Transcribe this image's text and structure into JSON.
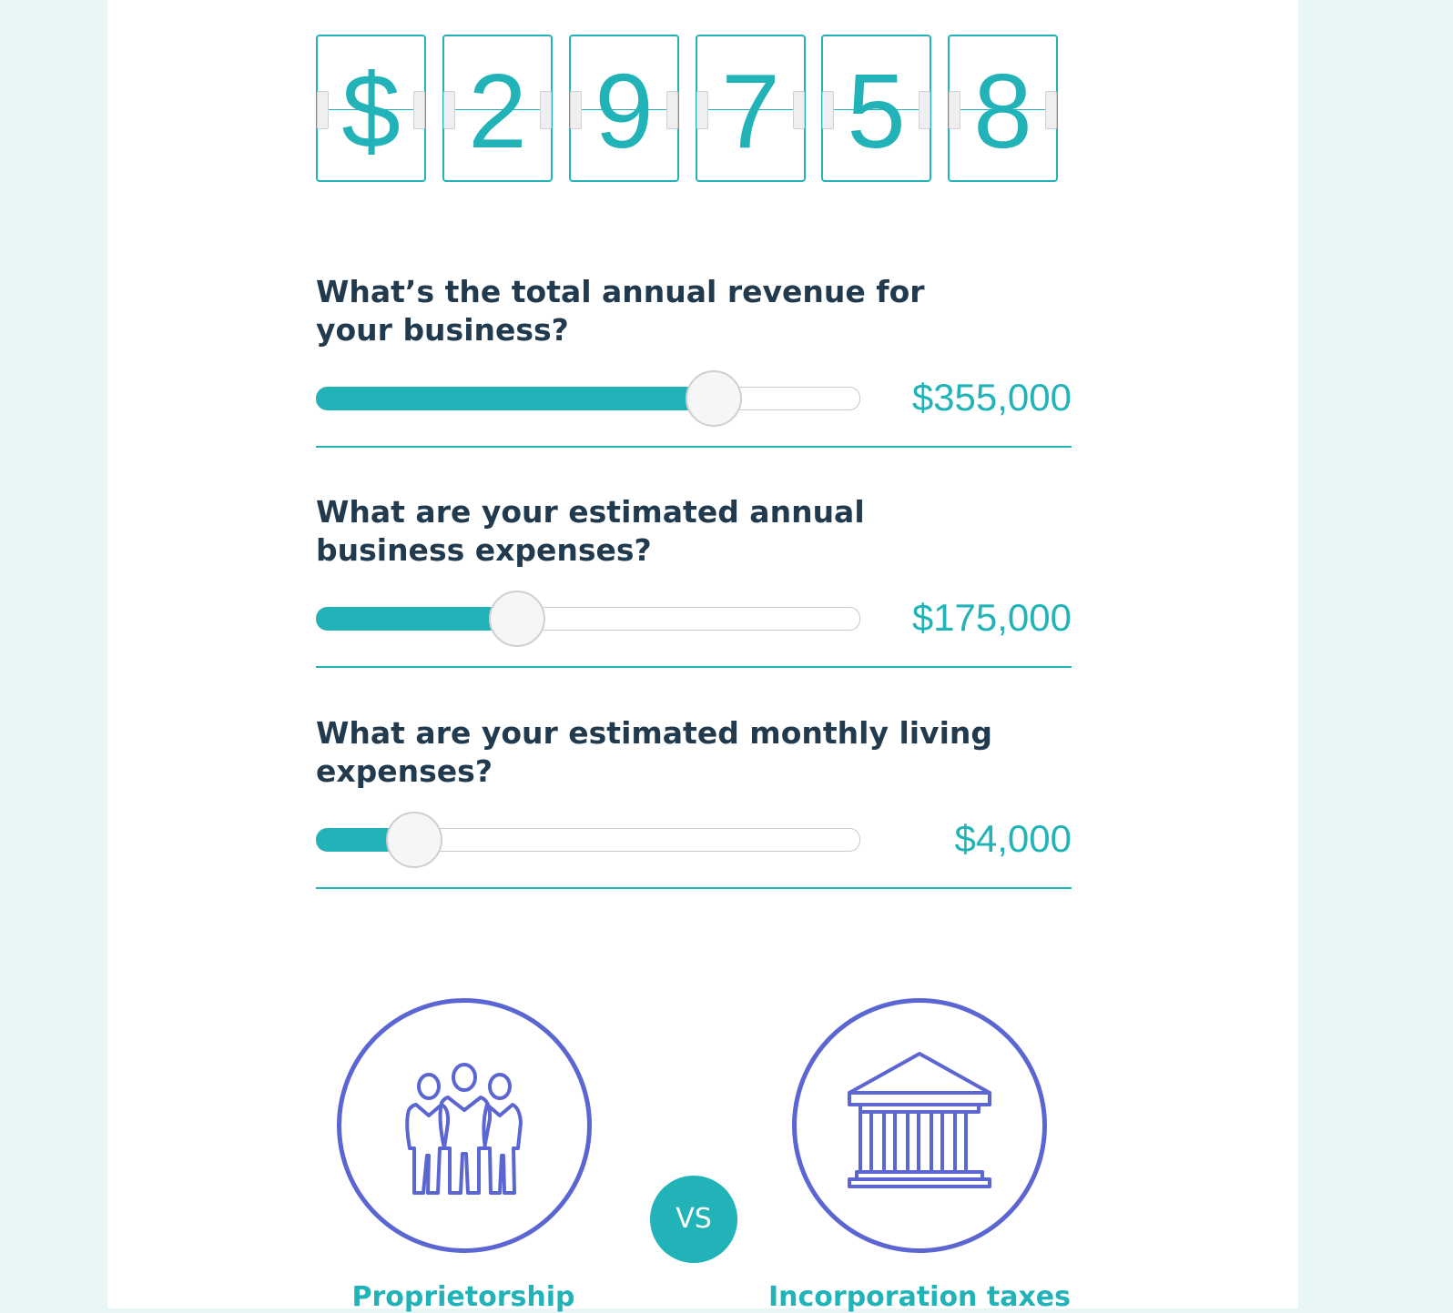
{
  "result": {
    "digits": [
      "$",
      "2",
      "9",
      "7",
      "5",
      "8"
    ]
  },
  "questions": [
    {
      "label": "What’s the total annual revenue for your business?",
      "value": "$355,000",
      "fill_fraction": 0.73
    },
    {
      "label": "What are your estimated annual business expenses?",
      "value": "$175,000",
      "fill_fraction": 0.37
    },
    {
      "label": "What are your estimated monthly living expenses?",
      "value": "$4,000",
      "fill_fraction": 0.18
    }
  ],
  "comparison": {
    "left_caption": "Proprietorship",
    "vs_label": "VS",
    "right_caption": "Incorporation taxes",
    "left_icon": "people-group-icon",
    "right_icon": "bank-building-icon"
  },
  "colors": {
    "accent": "#22b3b8",
    "heading": "#223a4e",
    "icon": "#5b66d3",
    "background": "#e8f7f6"
  }
}
